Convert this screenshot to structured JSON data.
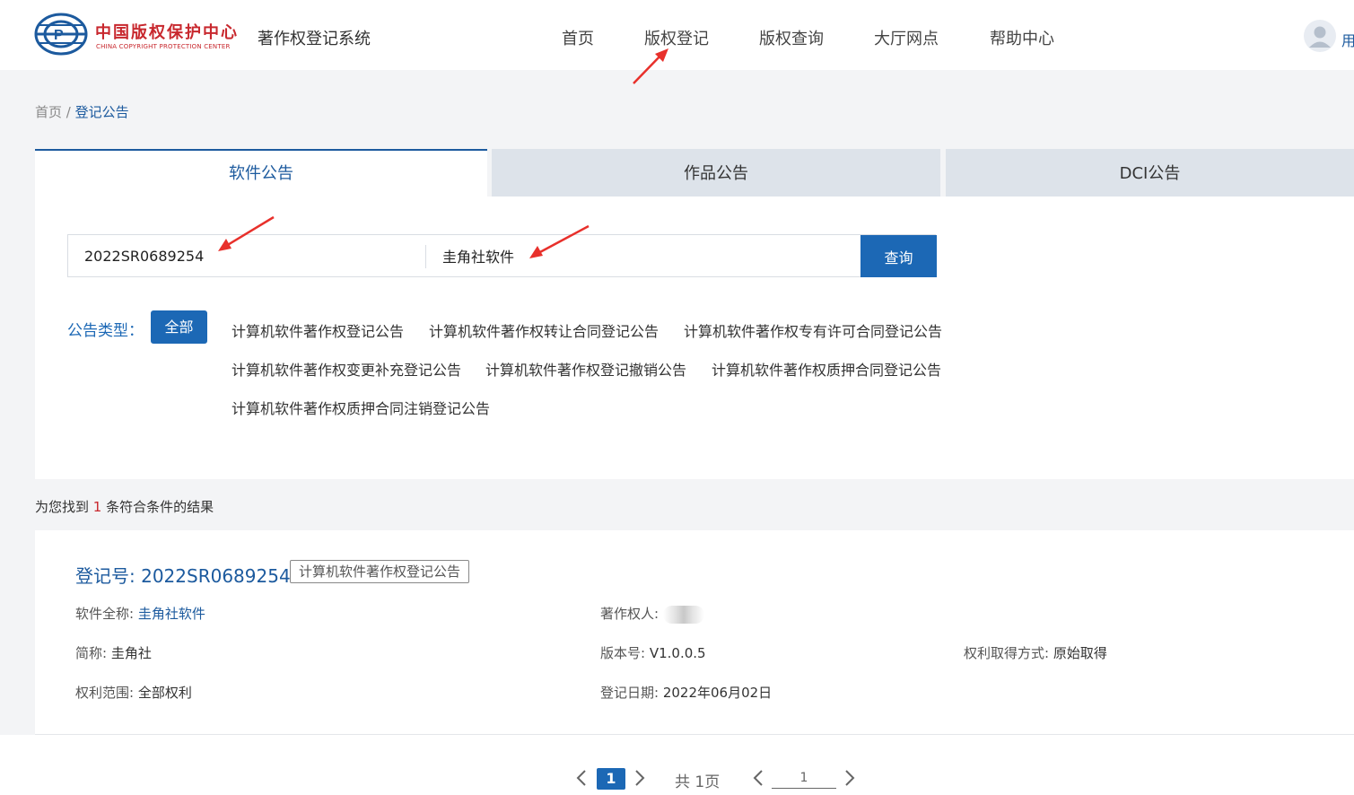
{
  "header": {
    "logo_cn": "中国版权保护中心",
    "logo_en": "CHINA COPYRIGHT PROTECTION CENTER",
    "system_title": "著作权登记系统",
    "nav": [
      "首页",
      "版权登记",
      "版权查询",
      "大厅网点",
      "帮助中心"
    ],
    "user_label": "用"
  },
  "breadcrumb": {
    "home": "首页",
    "separator": " / ",
    "current": "登记公告"
  },
  "tabs": [
    {
      "label": "软件公告",
      "active": true
    },
    {
      "label": "作品公告",
      "active": false
    },
    {
      "label": "DCI公告",
      "active": false
    }
  ],
  "search": {
    "reg_no_value": "2022SR0689254",
    "name_value": "圭角社软件",
    "button_label": "查询"
  },
  "filter": {
    "label": "公告类型：",
    "all_label": "全部",
    "options": [
      "计算机软件著作权登记公告",
      "计算机软件著作权转让合同登记公告",
      "计算机软件著作权专有许可合同登记公告",
      "计算机软件著作权变更补充登记公告",
      "计算机软件著作权登记撤销公告",
      "计算机软件著作权质押合同登记公告",
      "计算机软件著作权质押合同注销登记公告"
    ]
  },
  "results": {
    "prefix": "为您找到",
    "count": "1",
    "suffix": "条符合条件的结果",
    "items": [
      {
        "reg_no_label": "登记号: ",
        "reg_no": "2022SR0689254",
        "tag": "计算机软件著作权登记公告",
        "full_name_label": "软件全称: ",
        "full_name": "圭角社软件",
        "owner_label": "著作权人: ",
        "short_name_label": "简称: ",
        "short_name": "圭角社",
        "version_label": "版本号: ",
        "version": "V1.0.0.5",
        "acquire_label": "权利取得方式: ",
        "acquire": "原始取得",
        "scope_label": "权利范围: ",
        "scope": "全部权利",
        "date_label": "登记日期: ",
        "date": "2022年06月02日"
      }
    ]
  },
  "pagination": {
    "current": "1",
    "total_text": "共 1页",
    "jump_value": "1"
  },
  "colors": {
    "primary": "#1c68b5",
    "link": "#1c5a9e",
    "logo_red": "#c8282e",
    "annotation_arrow": "#e8302b"
  },
  "icons": [
    "logo-icon",
    "user-avatar-icon",
    "chevron-left-icon",
    "chevron-right-icon",
    "annotation-arrow"
  ]
}
